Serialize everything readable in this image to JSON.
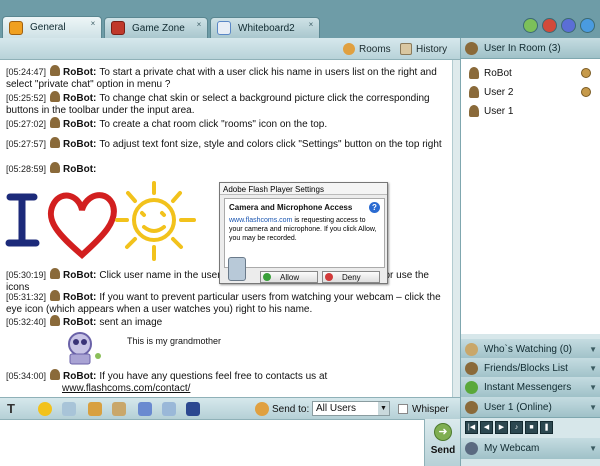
{
  "tabs": [
    {
      "label": "General",
      "color": "#f0a020"
    },
    {
      "label": "Game Zone",
      "color": "#c0392b"
    },
    {
      "label": "Whiteboard2",
      "color": "#5a87c6"
    }
  ],
  "chat_toolbar": {
    "rooms": "Rooms",
    "history": "History"
  },
  "messages": [
    {
      "time": "[05:24:47]",
      "name": "RoBot:",
      "text": "To start a private chat with a user click his name in users list on the right and select \"private chat\" option in menu ?"
    },
    {
      "time": "[05:25:52]",
      "name": "RoBot:",
      "text": "To change chat skin or select a background picture click the corresponding buttons in the toolbar under the input area."
    },
    {
      "time": "[05:27:02]",
      "name": "RoBot:",
      "text": "To create a chat room click \"rooms\" icon on the top."
    },
    {
      "time": "[05:27:57]",
      "name": "RoBot:",
      "text": "To adjust text font size, style and colors click \"Settings\" button on the top right"
    },
    {
      "time": "[05:28:59]",
      "name": "RoBot:",
      "text": ""
    },
    {
      "time": "[05:30:19]",
      "name": "RoBot:",
      "text": "Click user name in the users list to start a private chat with hime or use the icons"
    },
    {
      "time": "[05:31:32]",
      "name": "RoBot:",
      "text": "If you want to prevent particular users from watching your webcam – click the eye icon (which appears when a user watches you) right to his name."
    },
    {
      "time": "[05:32:40]",
      "name": "RoBot:",
      "text": "sent an image"
    },
    {
      "time": "[05:34:00]",
      "name": "RoBot:",
      "text": "If you have any questions feel free to contacts us at",
      "link": "www.flashcoms.com/contact/"
    }
  ],
  "image_caption": "This is my grandmother",
  "flash_dialog": {
    "title": "Adobe Flash Player Settings",
    "heading": "Camera and Microphone Access",
    "domain": "www.flashcoms.com",
    "body": " is requesting access to your camera and microphone. If you click Allow, you may be recorded.",
    "allow": "Allow",
    "deny": "Deny"
  },
  "right_panel": {
    "users_header": "User In Room (3)",
    "users": [
      "RoBot",
      "User 2",
      "User 1"
    ],
    "whos_watching": "Who`s Watching (0)",
    "friends": "Friends/Blocks List",
    "messengers": "Instant Messengers",
    "current_user": "User 1 (Online)",
    "webcam": "My Webcam"
  },
  "bottom_toolbar": {
    "font_label": "T",
    "send_to_label": "Send to:",
    "send_to_value": "All Users",
    "whisper_label": "Whisper",
    "send_label": "Send"
  },
  "colors": {
    "tabbar": "#6e9ca7",
    "panel": "#d7e7ea",
    "accent_green": "#7fae52"
  }
}
